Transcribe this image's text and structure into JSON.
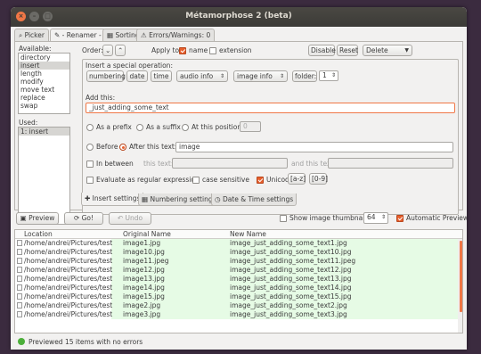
{
  "window": {
    "title": "Métamorphose 2 (beta)"
  },
  "tabs": [
    {
      "label": "Picker"
    },
    {
      "label": "- Renamer -"
    },
    {
      "label": "Sorting"
    },
    {
      "label": "Errors/Warnings: 0"
    }
  ],
  "operations": {
    "available_label": "Available:",
    "available": [
      "directory",
      "insert",
      "length",
      "modify",
      "move text",
      "replace",
      "swap"
    ],
    "used_label": "Used:",
    "used": [
      "1: insert"
    ]
  },
  "top": {
    "order_label": "Order:",
    "apply_label": "Apply to:",
    "name": "name",
    "extension": "extension",
    "disable": "Disable",
    "reset": "Reset",
    "delete": "Delete"
  },
  "insert_special": {
    "label": "Insert a special operation:",
    "numbering": "numbering",
    "date": "date",
    "time": "time",
    "audio": "audio info",
    "image": "image info",
    "folder_label": "folder:",
    "folder_value": "1"
  },
  "add_this": {
    "label": "Add this:",
    "value": "_just_adding_some_text"
  },
  "position": {
    "prefix": "As a prefix",
    "suffix": "As a suffix",
    "at": "At this position:",
    "at_value": "0"
  },
  "before_after": {
    "before": "Before",
    "after": "After",
    "this_text": "this text:",
    "value": "image"
  },
  "between": {
    "label": "In between",
    "this_text": "this text:",
    "and_this": "and this text:"
  },
  "options": {
    "regex": "Evaluate as regular expression",
    "case": "case sensitive",
    "unicode": "Unicode",
    "az": "[a-z]",
    "num": "[0-9]"
  },
  "bottom_tabs": [
    {
      "label": "Insert settings"
    },
    {
      "label": "Numbering settings"
    },
    {
      "label": "Date & Time settings"
    }
  ],
  "toolbar": {
    "preview": "Preview",
    "go": "Go!",
    "undo": "Undo",
    "thumbs": "Show image thumbnails",
    "thumb_size": "64",
    "auto": "Automatic Preview"
  },
  "table": {
    "headers": [
      "Location",
      "Original Name",
      "New Name"
    ],
    "rows": [
      [
        "/home/andrei/Pictures/test",
        "image1.jpg",
        "image_just_adding_some_text1.jpg"
      ],
      [
        "/home/andrei/Pictures/test",
        "image10.jpg",
        "image_just_adding_some_text10.jpg"
      ],
      [
        "/home/andrei/Pictures/test",
        "image11.jpeg",
        "image_just_adding_some_text11.jpeg"
      ],
      [
        "/home/andrei/Pictures/test",
        "image12.jpg",
        "image_just_adding_some_text12.jpg"
      ],
      [
        "/home/andrei/Pictures/test",
        "image13.jpg",
        "image_just_adding_some_text13.jpg"
      ],
      [
        "/home/andrei/Pictures/test",
        "image14.jpg",
        "image_just_adding_some_text14.jpg"
      ],
      [
        "/home/andrei/Pictures/test",
        "image15.jpg",
        "image_just_adding_some_text15.jpg"
      ],
      [
        "/home/andrei/Pictures/test",
        "image2.jpg",
        "image_just_adding_some_text2.jpg"
      ],
      [
        "/home/andrei/Pictures/test",
        "image3.jpg",
        "image_just_adding_some_text3.jpg"
      ]
    ]
  },
  "status": {
    "text": "Previewed 15 items with no errors"
  },
  "colors": {
    "accent": "#f07746",
    "match_bg": "#e6fbe5"
  }
}
